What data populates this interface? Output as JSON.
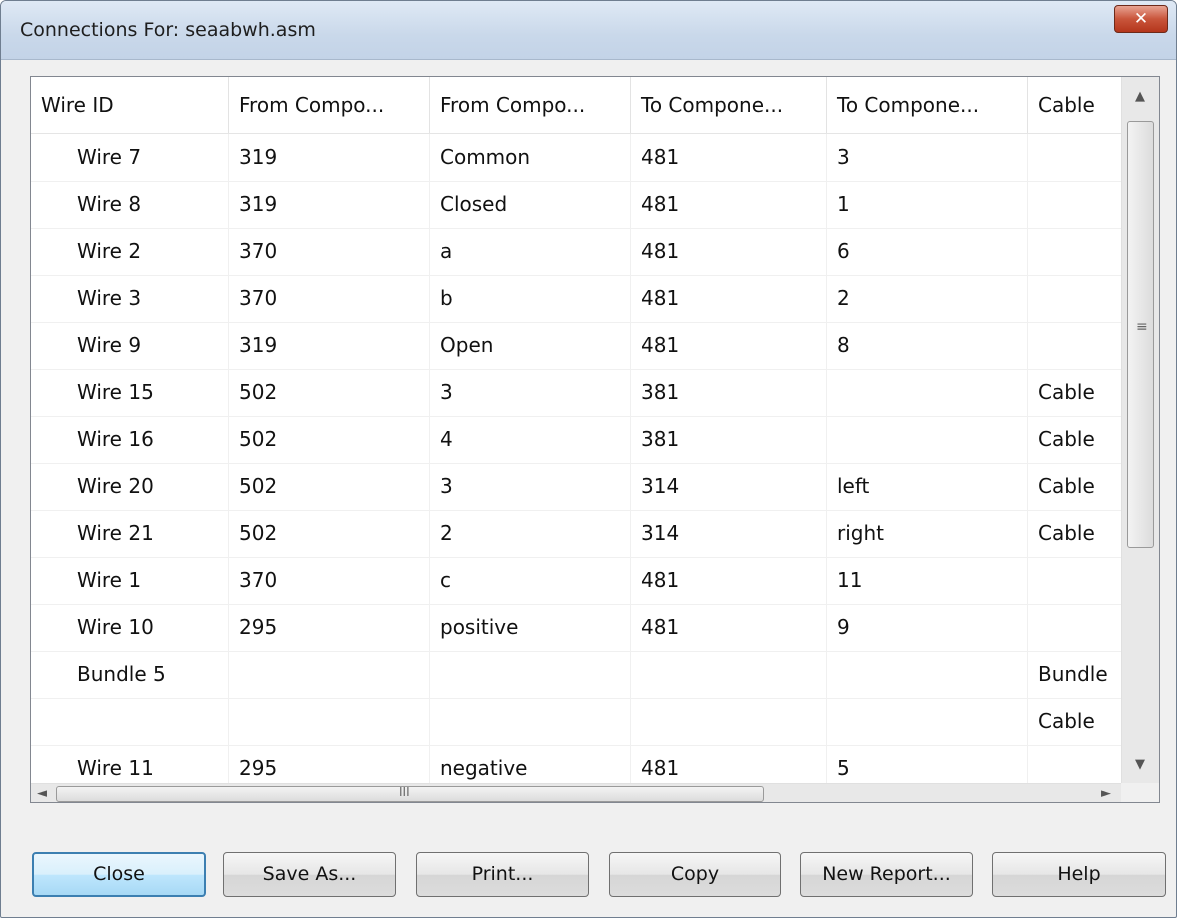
{
  "window": {
    "title": "Connections For: seaabwh.asm",
    "close_glyph": "✕"
  },
  "table": {
    "columns": [
      "Wire ID",
      "From Compo...",
      "From Compo...",
      "To Compone...",
      "To Compone...",
      "Cable"
    ],
    "rows": [
      [
        "Wire 7",
        "319",
        "Common",
        "481",
        "3",
        ""
      ],
      [
        "Wire 8",
        "319",
        "Closed",
        "481",
        "1",
        ""
      ],
      [
        "Wire 2",
        "370",
        "a",
        "481",
        "6",
        ""
      ],
      [
        "Wire 3",
        "370",
        "b",
        "481",
        "2",
        ""
      ],
      [
        "Wire 9",
        "319",
        "Open",
        "481",
        "8",
        ""
      ],
      [
        "Wire 15",
        "502",
        "3",
        "381",
        "",
        "Cable"
      ],
      [
        "Wire 16",
        "502",
        "4",
        "381",
        "",
        "Cable"
      ],
      [
        "Wire 20",
        "502",
        "3",
        "314",
        "left",
        "Cable"
      ],
      [
        "Wire 21",
        "502",
        "2",
        "314",
        "right",
        "Cable"
      ],
      [
        "Wire 1",
        "370",
        "c",
        "481",
        "11",
        ""
      ],
      [
        "Wire 10",
        "295",
        "positive",
        "481",
        "9",
        ""
      ],
      [
        "Bundle 5",
        "",
        "",
        "",
        "",
        "Bundle"
      ],
      [
        "",
        "",
        "",
        "",
        "",
        "Cable"
      ],
      [
        "Wire 11",
        "295",
        "negative",
        "481",
        "5",
        ""
      ]
    ]
  },
  "scrollbars": {
    "up": "▲",
    "down": "▼",
    "left": "◄",
    "right": "►",
    "grip_v": "≡",
    "grip_h": "III"
  },
  "buttons": {
    "close": "Close",
    "save_as": "Save As...",
    "print": "Print...",
    "copy": "Copy",
    "new_report": "New Report...",
    "help": "Help"
  }
}
